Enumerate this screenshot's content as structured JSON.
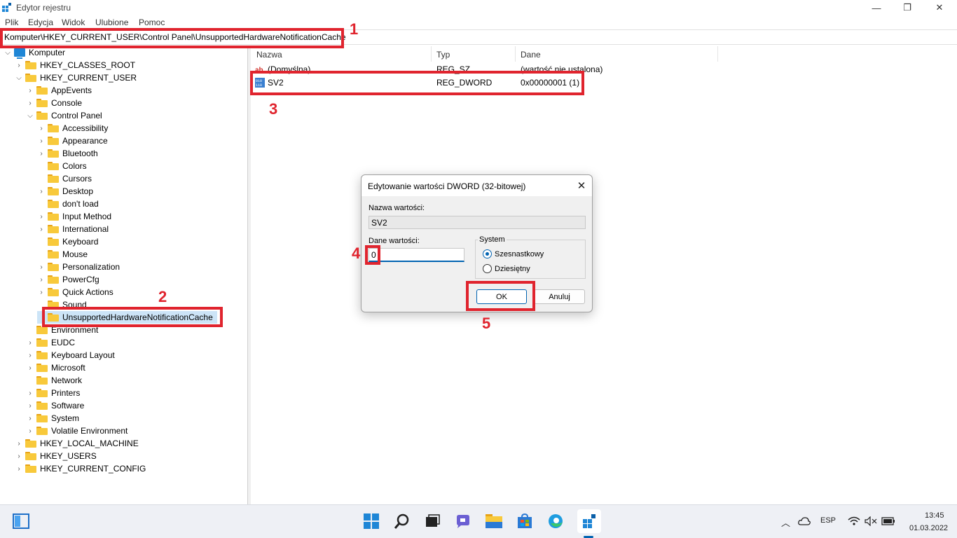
{
  "window": {
    "title": "Edytor rejestru",
    "min_glyph": "—",
    "max_glyph": "❐",
    "close_glyph": "✕"
  },
  "menu": [
    "Plik",
    "Edycja",
    "Widok",
    "Ulubione",
    "Pomoc"
  ],
  "address": "Komputer\\HKEY_CURRENT_USER\\Control Panel\\UnsupportedHardwareNotificationCache",
  "tree": {
    "root": "Komputer",
    "items": [
      {
        "label": "HKEY_CLASSES_ROOT"
      },
      {
        "label": "HKEY_CURRENT_USER"
      },
      {
        "label": "AppEvents"
      },
      {
        "label": "Console"
      },
      {
        "label": "Control Panel"
      },
      {
        "label": "Accessibility"
      },
      {
        "label": "Appearance"
      },
      {
        "label": "Bluetooth"
      },
      {
        "label": "Colors"
      },
      {
        "label": "Cursors"
      },
      {
        "label": "Desktop"
      },
      {
        "label": "don't load"
      },
      {
        "label": "Input Method"
      },
      {
        "label": "International"
      },
      {
        "label": "Keyboard"
      },
      {
        "label": "Mouse"
      },
      {
        "label": "Personalization"
      },
      {
        "label": "PowerCfg"
      },
      {
        "label": "Quick Actions"
      },
      {
        "label": "Sound"
      },
      {
        "label": "UnsupportedHardwareNotificationCache"
      },
      {
        "label": "Environment"
      },
      {
        "label": "EUDC"
      },
      {
        "label": "Keyboard Layout"
      },
      {
        "label": "Microsoft"
      },
      {
        "label": "Network"
      },
      {
        "label": "Printers"
      },
      {
        "label": "Software"
      },
      {
        "label": "System"
      },
      {
        "label": "Volatile Environment"
      },
      {
        "label": "HKEY_LOCAL_MACHINE"
      },
      {
        "label": "HKEY_USERS"
      },
      {
        "label": "HKEY_CURRENT_CONFIG"
      }
    ]
  },
  "list": {
    "columns": [
      "Nazwa",
      "Typ",
      "Dane"
    ],
    "rows": [
      {
        "name": "(Domyślna)",
        "type": "REG_SZ",
        "data": "(wartość nie ustalona)",
        "icon": "string-value-icon"
      },
      {
        "name": "SV2",
        "type": "REG_DWORD",
        "data": "0x00000001 (1)",
        "icon": "dword-value-icon"
      }
    ]
  },
  "dialog": {
    "title": "Edytowanie wartości DWORD (32-bitowej)",
    "close_glyph": "✕",
    "name_label": "Nazwa wartości:",
    "name_value": "SV2",
    "data_label": "Dane wartości:",
    "data_value": "0",
    "base_label": "System",
    "base_hex": "Szesnastkowy",
    "base_dec": "Dziesiętny",
    "selected_base": "Szesnastkowy",
    "ok": "OK",
    "cancel": "Anuluj"
  },
  "annotations": [
    "1",
    "2",
    "3",
    "4",
    "5"
  ],
  "taskbar": {
    "icons": [
      "start-icon",
      "search-icon",
      "task-view-icon",
      "chat-icon",
      "file-explorer-icon",
      "store-icon",
      "edge-icon",
      "regedit-icon"
    ],
    "lang": "ESP",
    "time": "13:45",
    "date": "01.03.2022"
  },
  "colors": {
    "annotation_red": "#e0242e",
    "accent_blue": "#0063b1",
    "folder_yellow": "#f8c93b"
  }
}
